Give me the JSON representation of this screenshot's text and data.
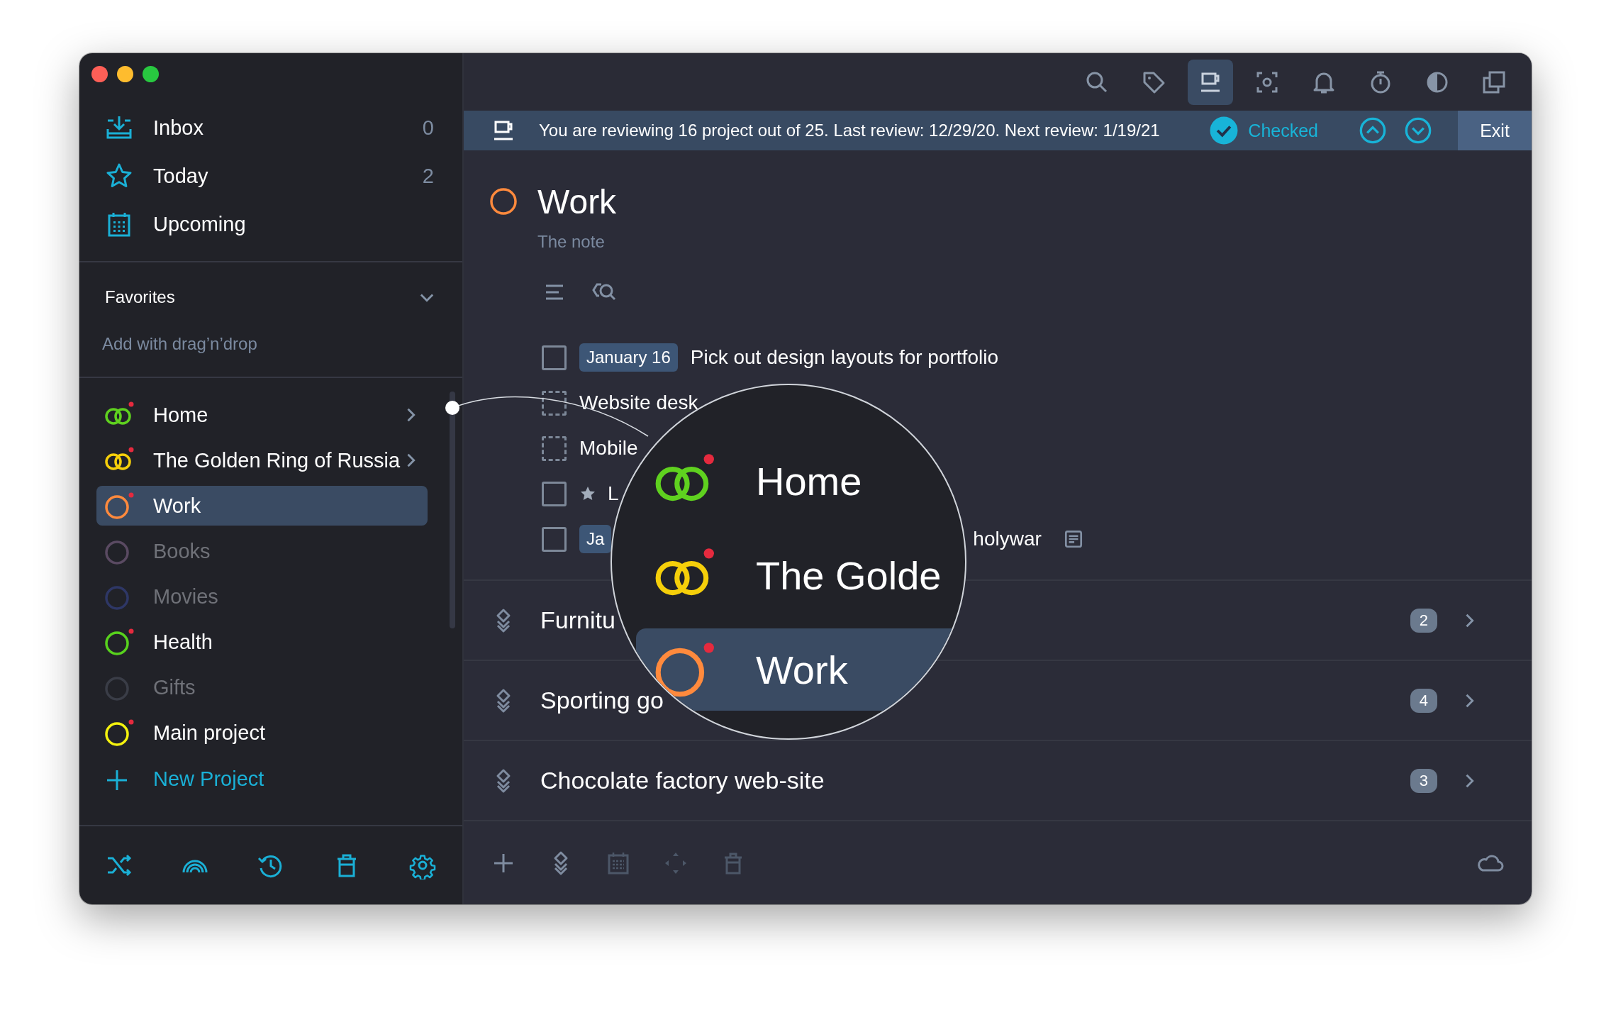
{
  "toolbar": [
    {
      "selected": false
    },
    {
      "selected": false
    },
    {
      "selected": true
    },
    {
      "selected": false
    },
    {
      "selected": false
    },
    {
      "selected": false
    },
    {
      "selected": false
    },
    {
      "selected": false
    }
  ],
  "sidebar": {
    "nav": [
      {
        "label": "Inbox",
        "count": "0"
      },
      {
        "label": "Today",
        "count": "2"
      },
      {
        "label": "Upcoming"
      }
    ],
    "favorites": {
      "title": "Favorites",
      "expanded": true,
      "hint": "Add with drag’n’drop"
    },
    "projects": [
      {
        "kind": "area",
        "name": "Home",
        "color": "#5fd11f",
        "flagged": true,
        "dimmed": false,
        "selected": false
      },
      {
        "kind": "area",
        "name": "The Golden Ring of Russia",
        "color": "#f5cf0a",
        "flagged": true,
        "dimmed": false,
        "selected": false
      },
      {
        "kind": "project",
        "name": "Work",
        "color": "#ff8a3d",
        "flagged": true,
        "dimmed": false,
        "selected": true
      },
      {
        "kind": "project",
        "name": "Books",
        "color": "#5a4a62",
        "flagged": false,
        "dimmed": true,
        "selected": false
      },
      {
        "kind": "project",
        "name": "Movies",
        "color": "#2e3766",
        "flagged": false,
        "dimmed": true,
        "selected": false
      },
      {
        "kind": "project",
        "name": "Health",
        "color": "#58d21d",
        "flagged": true,
        "dimmed": false,
        "selected": false
      },
      {
        "kind": "project",
        "name": "Gifts",
        "color": "#3a3d47",
        "flagged": false,
        "dimmed": true,
        "selected": false
      },
      {
        "kind": "project",
        "name": "Main project",
        "color": "#f4f20e",
        "flagged": true,
        "dimmed": false,
        "selected": false
      }
    ],
    "new_project": "New Project"
  },
  "review_bar": {
    "message": "You are reviewing 16 project out of 25. Last review: 12/29/20. Next review: 1/19/21",
    "status": "Checked",
    "checked": true,
    "exit": "Exit"
  },
  "project": {
    "title": "Work",
    "color": "#ff8a3d",
    "note": "The note"
  },
  "tasks": [
    {
      "kind": "task",
      "checked": false,
      "starred": false,
      "has_note": false,
      "date": "January 16",
      "title": "Pick out design layouts for portfolio"
    },
    {
      "kind": "draft",
      "starred": false,
      "title": "Website desk"
    },
    {
      "kind": "draft",
      "starred": false,
      "title": "Mobile"
    },
    {
      "kind": "task",
      "checked": false,
      "starred": true,
      "title": "L"
    },
    {
      "kind": "task",
      "checked": false,
      "starred": false,
      "has_note": true,
      "date": "Ja",
      "title_end": "holywar"
    }
  ],
  "sections": [
    {
      "title": "Furnitu",
      "count": "2"
    },
    {
      "title": "Sporting go",
      "count": "4"
    },
    {
      "title": "Chocolate factory web-site",
      "count": "3"
    }
  ],
  "magnifier": {
    "rows": [
      {
        "kind": "area",
        "name": "Home",
        "color": "#5fd11f",
        "flagged": true,
        "selected": false
      },
      {
        "kind": "area",
        "name": "The Golde",
        "color": "#f5cf0a",
        "flagged": true,
        "selected": false
      },
      {
        "kind": "project",
        "name": "Work",
        "color": "#ff8a3d",
        "flagged": true,
        "selected": true
      }
    ]
  }
}
